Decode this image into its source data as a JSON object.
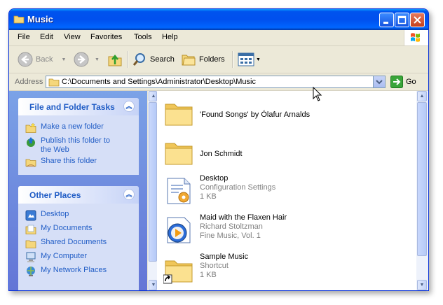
{
  "window": {
    "title": "Music"
  },
  "menu": [
    "File",
    "Edit",
    "View",
    "Favorites",
    "Tools",
    "Help"
  ],
  "toolbar": {
    "back": "Back",
    "search": "Search",
    "folders": "Folders"
  },
  "address": {
    "label": "Address",
    "path": "C:\\Documents and Settings\\Administrator\\Desktop\\Music",
    "go": "Go"
  },
  "file_tasks": {
    "title": "File and Folder Tasks",
    "items": [
      "Make a new folder",
      "Publish this folder to the Web",
      "Share this folder"
    ]
  },
  "other_places": {
    "title": "Other Places",
    "items": [
      "Desktop",
      "My Documents",
      "Shared Documents",
      "My Computer",
      "My Network Places"
    ]
  },
  "files": [
    {
      "name": "'Found Songs' by Ólafur Arnalds",
      "icon": "folder-icon"
    },
    {
      "name": "Jon Schmidt",
      "icon": "folder-icon"
    },
    {
      "name": "Desktop",
      "line2": "Configuration Settings",
      "line3": "1 KB",
      "icon": "config-settings-icon"
    },
    {
      "name": "Maid with the Flaxen Hair",
      "line2": "Richard Stoltzman",
      "line3": "Fine Music, Vol. 1",
      "icon": "media-player-icon"
    },
    {
      "name": "Sample Music",
      "line2": "Shortcut",
      "line3": "1 KB",
      "icon": "folder-shortcut-icon"
    }
  ],
  "colors": {
    "titlebar": "#0053ee",
    "link": "#215dc6",
    "taskpane": "#7ba2e7"
  }
}
